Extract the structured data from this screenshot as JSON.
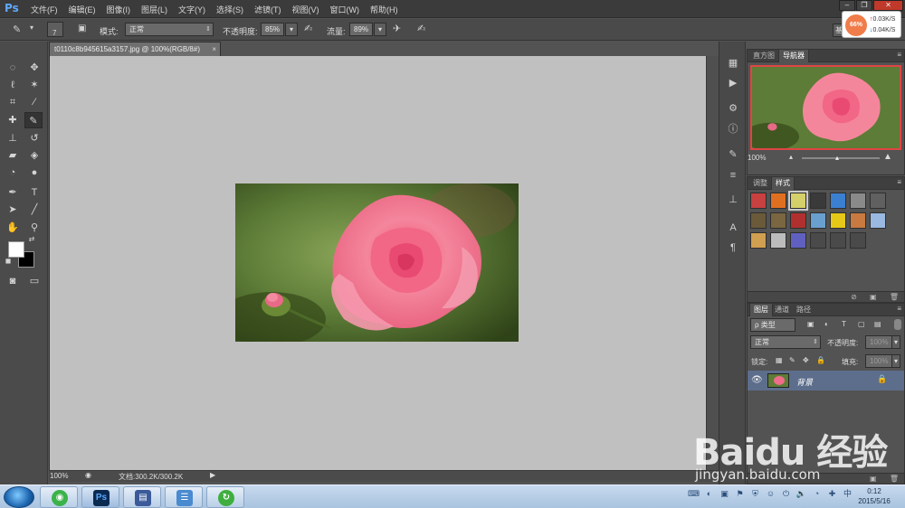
{
  "app": {
    "logo": "Ps"
  },
  "menu": [
    "文件(F)",
    "编辑(E)",
    "图像(I)",
    "图层(L)",
    "文字(Y)",
    "选择(S)",
    "滤镜(T)",
    "视图(V)",
    "窗口(W)",
    "帮助(H)"
  ],
  "network_widget": {
    "percent": "66%",
    "up": "0.03K/S",
    "down": "0.04K/S"
  },
  "options_bar": {
    "brush_size": "7",
    "mode_label": "模式:",
    "mode_value": "正常",
    "opacity_label": "不透明度:",
    "opacity_value": "85%",
    "flow_label": "流量:",
    "flow_value": "89%",
    "right_button": "基"
  },
  "document": {
    "tab_title": "t0110c8b945615a3157.jpg @ 100%(RGB/8#)",
    "tab_close": "×"
  },
  "status_bar": {
    "zoom": "100%",
    "doc_info": "文档:300.2K/300.2K"
  },
  "navigator_panel": {
    "tabs": [
      "直方图",
      "导航器"
    ],
    "active_tab": "导航器",
    "zoom": "100%"
  },
  "styles_panel": {
    "tabs": [
      "调整",
      "样式"
    ],
    "active_tab": "样式",
    "swatches": [
      "#c84040",
      "#e07020",
      "#d6d06a",
      "#3a3a3a",
      "#3b7fd0",
      "#8a8a8a",
      "#606060",
      "#6a5a3a",
      "#7a6640",
      "#b03030",
      "#6aa0d0",
      "#e6c818",
      "#c87a40",
      "#9ab8e0",
      "#d0a050",
      "#bcbcbc",
      "#6060c0",
      "#4a4a4a",
      "#4a4a4a",
      "#4a4a4a"
    ]
  },
  "layers_panel": {
    "tabs": [
      "图层",
      "通道",
      "路径"
    ],
    "active_tab": "图层",
    "filter_label": "ρ 类型",
    "blend_mode": "正常",
    "opacity_label": "不透明度:",
    "opacity_value": "100%",
    "lock_label": "锁定:",
    "fill_label": "填充:",
    "fill_value": "100%",
    "layers": [
      {
        "name": "背景",
        "visible": true,
        "locked": true
      }
    ]
  },
  "taskbar": {
    "ps_icon": "Ps",
    "time": "0:12",
    "date": "2015/5/16"
  },
  "watermark": {
    "brand": "Baidu 经验",
    "url": "jingyan.baidu.com"
  }
}
